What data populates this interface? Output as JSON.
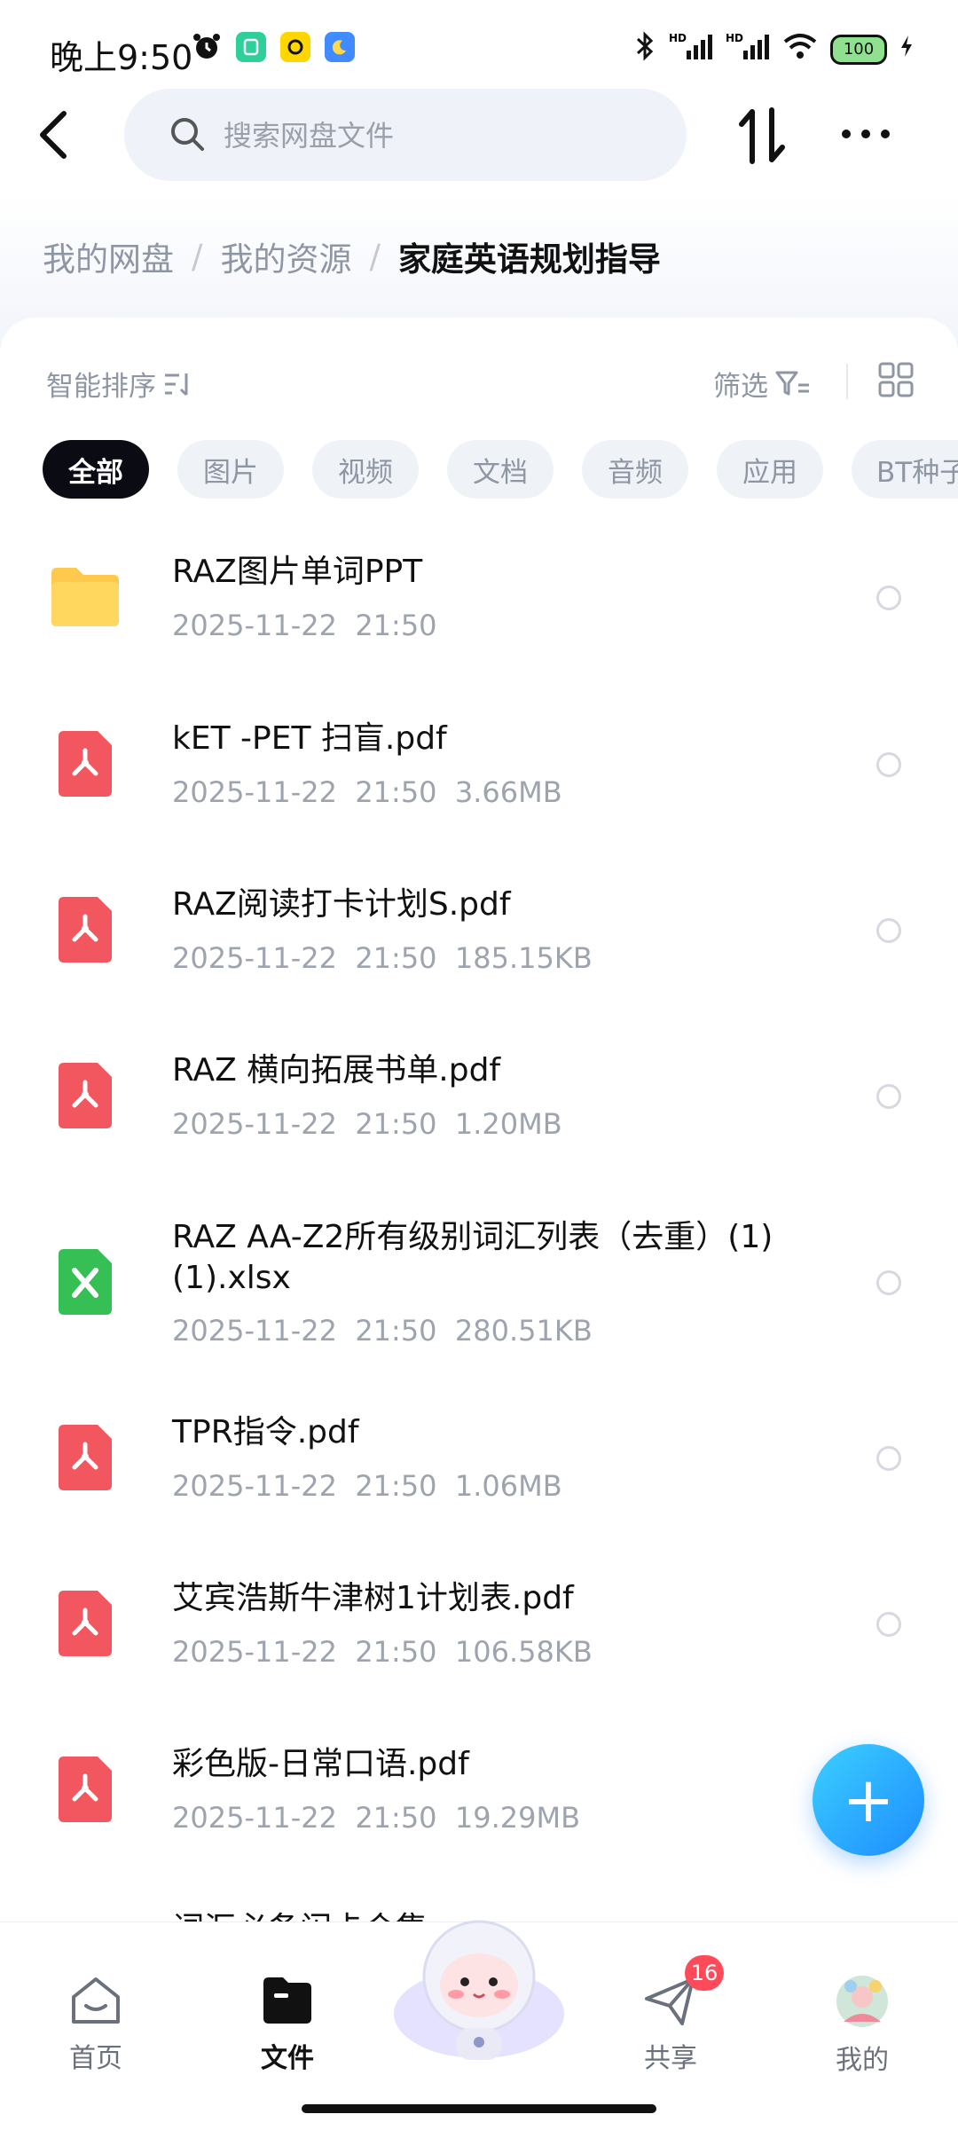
{
  "status_bar": {
    "time": "晚上9:50",
    "battery": "100"
  },
  "search": {
    "placeholder": "搜索网盘文件"
  },
  "breadcrumb": [
    "我的网盘",
    "我的资源",
    "家庭英语规划指导"
  ],
  "toolbar": {
    "sort_label": "智能排序",
    "filter_label": "筛选"
  },
  "chips": [
    "全部",
    "图片",
    "视频",
    "文档",
    "音频",
    "应用",
    "BT种子"
  ],
  "files": [
    {
      "name": "RAZ图片单词PPT",
      "date": "2025-11-22  21:50",
      "size": "",
      "type": "folder"
    },
    {
      "name": "kET -PET 扫盲.pdf",
      "date": "2025-11-22  21:50",
      "size": "3.66MB",
      "type": "pdf"
    },
    {
      "name": "RAZ阅读打卡计划S.pdf",
      "date": "2025-11-22  21:50",
      "size": "185.15KB",
      "type": "pdf"
    },
    {
      "name": "RAZ 横向拓展书单.pdf",
      "date": "2025-11-22  21:50",
      "size": "1.20MB",
      "type": "pdf"
    },
    {
      "name": "RAZ AA-Z2所有级别词汇列表（去重）(1)(1).xlsx",
      "date": "2025-11-22  21:50",
      "size": "280.51KB",
      "type": "xlsx"
    },
    {
      "name": "TPR指令.pdf",
      "date": "2025-11-22  21:50",
      "size": "1.06MB",
      "type": "pdf"
    },
    {
      "name": "艾宾浩斯牛津树1计划表.pdf",
      "date": "2025-11-22  21:50",
      "size": "106.58KB",
      "type": "pdf"
    },
    {
      "name": "彩色版-日常口语.pdf",
      "date": "2025-11-22  21:50",
      "size": "19.29MB",
      "type": "pdf"
    },
    {
      "name": "词汇必备闪卡合集",
      "date": "",
      "size": "",
      "type": "pdf"
    }
  ],
  "bottom_nav": [
    {
      "label": "首页",
      "icon": "home-icon"
    },
    {
      "label": "文件",
      "icon": "folder-icon"
    },
    {
      "label": "共享",
      "icon": "send-icon"
    },
    {
      "label": "我的",
      "icon": "avatar"
    }
  ],
  "share_badge": "16",
  "colors": {
    "pdf": "#f2575f",
    "xlsx": "#35bf55",
    "folder": "#ffc94d",
    "fab": "#1e8cff",
    "active_chip": "#0b0b14"
  }
}
